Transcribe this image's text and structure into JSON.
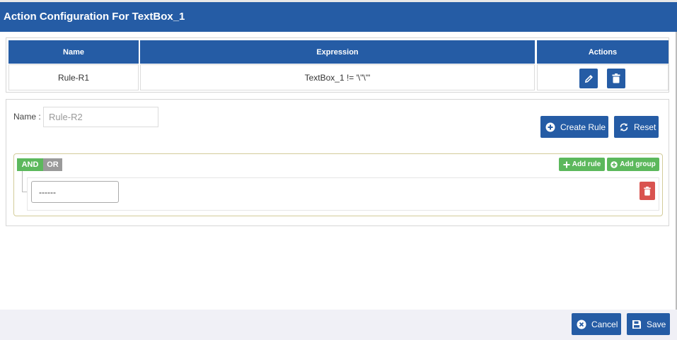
{
  "dialog": {
    "title": "Action Configuration For TextBox_1"
  },
  "rules_table": {
    "columns": [
      "Name",
      "Expression",
      "Actions"
    ],
    "rows": [
      {
        "name": "Rule-R1",
        "expression": "TextBox_1 != '\\\"\\\"'"
      }
    ],
    "edit_icon": "pencil-icon",
    "delete_icon": "trash-icon"
  },
  "form": {
    "name_label": "Name :",
    "name_placeholder": "Rule-R2",
    "create_rule_label": "Create Rule",
    "reset_label": "Reset"
  },
  "query_builder": {
    "conditions": [
      "AND",
      "OR"
    ],
    "active_condition": "AND",
    "add_rule_label": "Add rule",
    "add_group_label": "Add group",
    "field_select_value": "------"
  },
  "footer": {
    "cancel_label": "Cancel",
    "save_label": "Save"
  },
  "colors": {
    "primary": "#255ca5",
    "success": "#5cb85c",
    "danger": "#d9534f",
    "condition_inactive": "#9a9a9a"
  }
}
